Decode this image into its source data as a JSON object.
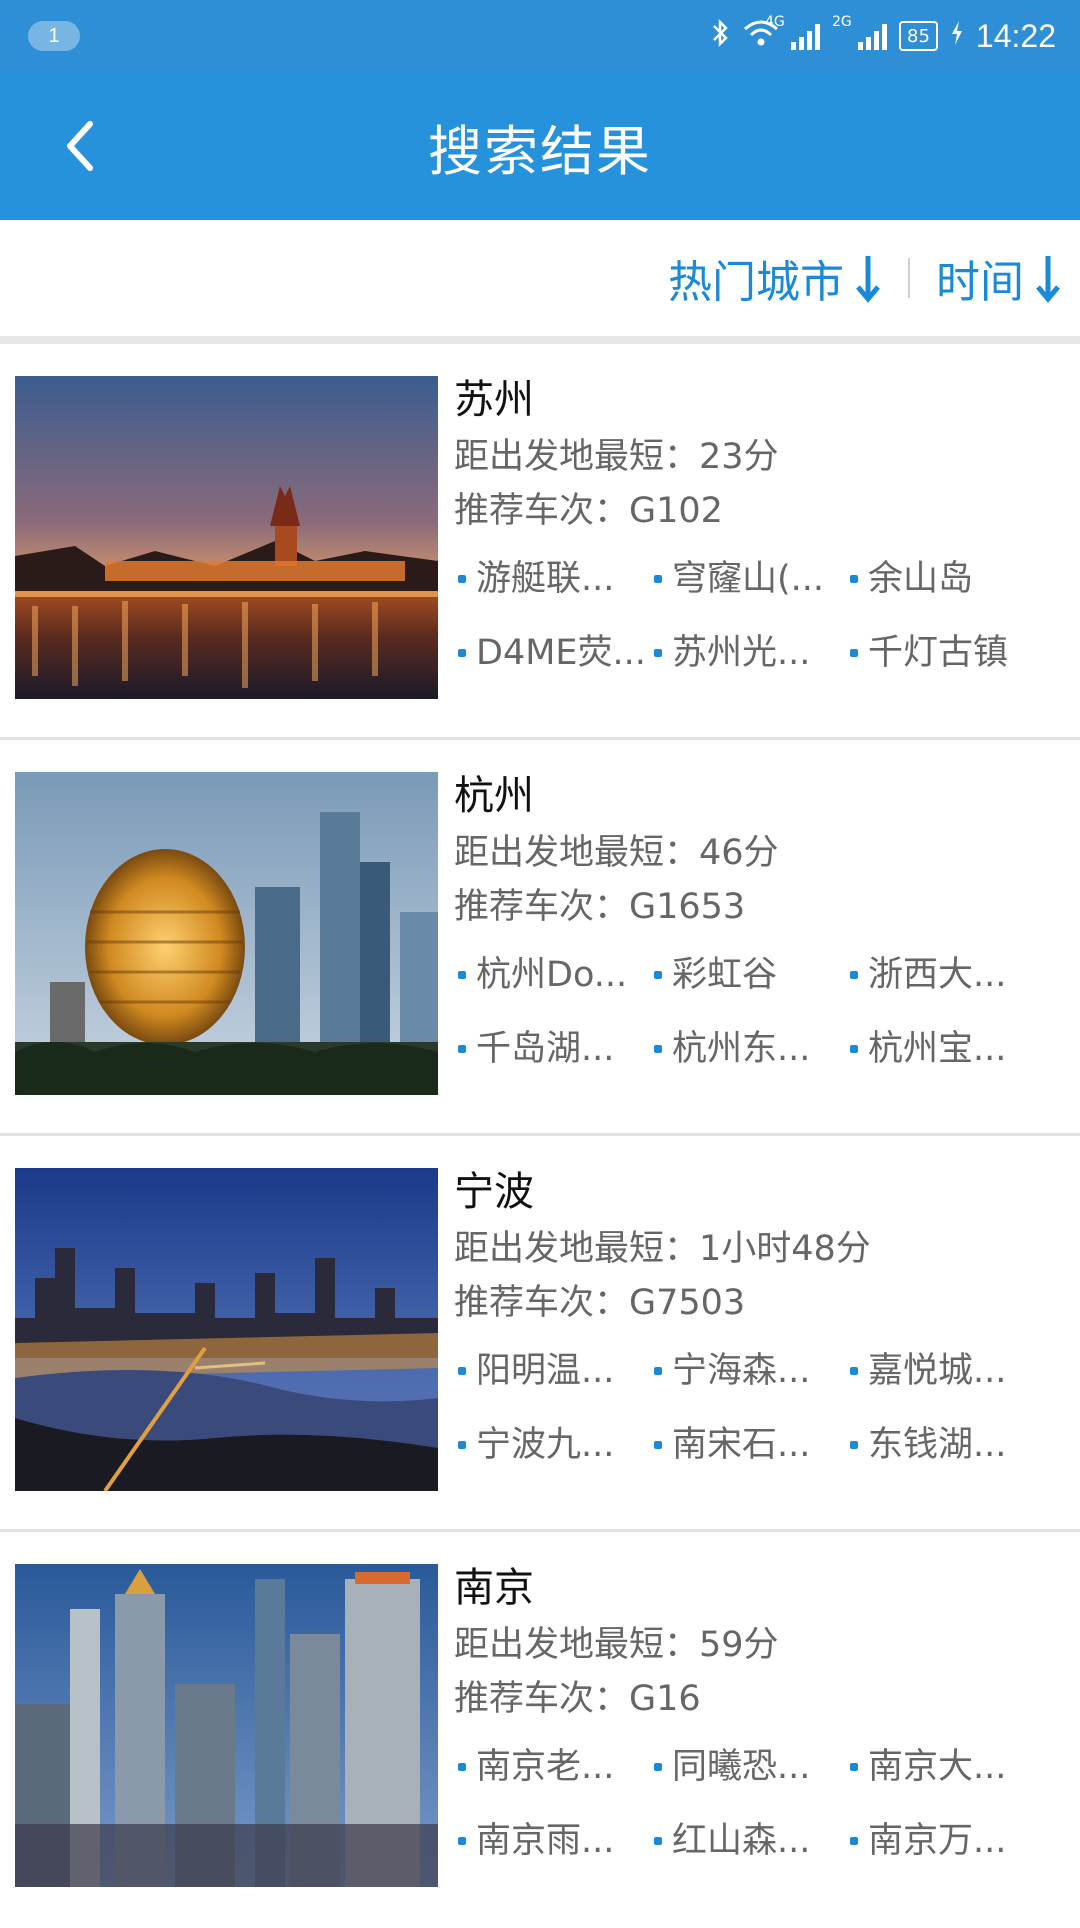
{
  "status_bar": {
    "notification_count": "1",
    "network_1": "4G",
    "network_2": "2G",
    "battery": "85",
    "time": "14:22"
  },
  "header": {
    "title": "搜索结果"
  },
  "filters": {
    "hot_cities": "热门城市",
    "time": "时间"
  },
  "colors": {
    "status_bar": "#2f8fd6",
    "title_bar": "#2592db",
    "accent": "#1a8ad8"
  },
  "results": [
    {
      "city": "苏州",
      "distance": "距出发地最短：23分",
      "train": "推荐车次：G102",
      "spots": [
        "游艇联...",
        "穹窿山(...",
        "余山岛",
        "D4ME荧...",
        "苏州光...",
        "千灯古镇"
      ]
    },
    {
      "city": "杭州",
      "distance": "距出发地最短：46分",
      "train": "推荐车次：G1653",
      "spots": [
        "杭州Do...",
        "彩虹谷",
        "浙西大...",
        "千岛湖...",
        "杭州东...",
        "杭州宝..."
      ]
    },
    {
      "city": "宁波",
      "distance": "距出发地最短：1小时48分",
      "train": "推荐车次：G7503",
      "spots": [
        "阳明温...",
        "宁海森...",
        "嘉悦城...",
        "宁波九...",
        "南宋石...",
        "东钱湖..."
      ]
    },
    {
      "city": "南京",
      "distance": "距出发地最短：59分",
      "train": "推荐车次：G16",
      "spots": [
        "南京老...",
        "同曦恐...",
        "南京大...",
        "南京雨...",
        "红山森...",
        "南京万..."
      ]
    }
  ]
}
